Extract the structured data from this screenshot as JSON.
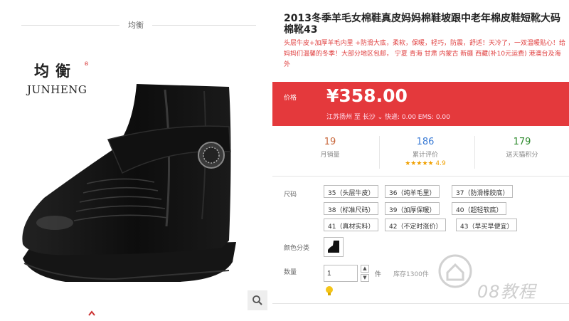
{
  "brand": {
    "section_title": "均衡",
    "logo_cn": "均衡",
    "logo_reg": "®",
    "logo_en": "JUNHENG"
  },
  "product": {
    "title": "2013冬季羊毛女棉鞋真皮妈妈棉鞋坡跟中老年棉皮鞋短靴大码棉靴43",
    "description": "头层牛皮+加厚羊毛内里 +防滑大底，柔软，保暖，轻巧，防震，舒适！天冷了，一双温暖贴心！给妈妈们温馨的冬季！大部分地区包邮， 宁夏 青海 甘肃 内蒙古 新疆 西藏(补10元运费) 港澳台及海外"
  },
  "price": {
    "label": "价格",
    "value": "¥358.00",
    "shipping": "江苏扬州 至  长沙 ⌄  快递: 0.00 EMS: 0.00"
  },
  "stats": [
    {
      "num": "19",
      "label": "月销量",
      "color": "#c8663a"
    },
    {
      "num": "186",
      "label": "累计评价",
      "color": "#3a7bd5",
      "stars": "★★★★★ 4.9"
    },
    {
      "num": "179",
      "label": "送天猫积分",
      "color": "#2e8b2e"
    }
  ],
  "options": {
    "size_label": "尺码",
    "sizes": [
      "35（头层牛皮）",
      "36（纯羊毛里）",
      "37（防滑橡胶底）",
      "38（标准尺码）",
      "39（加厚保暖）",
      "40（超轻软底）",
      "41（真材实料）",
      "42（不定时涨价）",
      "43（早买早便宜）"
    ],
    "color_label": "颜色分类",
    "qty_label": "数量",
    "qty_value": "1",
    "qty_unit": "件",
    "stock": "库存1300件"
  },
  "watermark": "08教程",
  "accent_color": "#e4393c"
}
